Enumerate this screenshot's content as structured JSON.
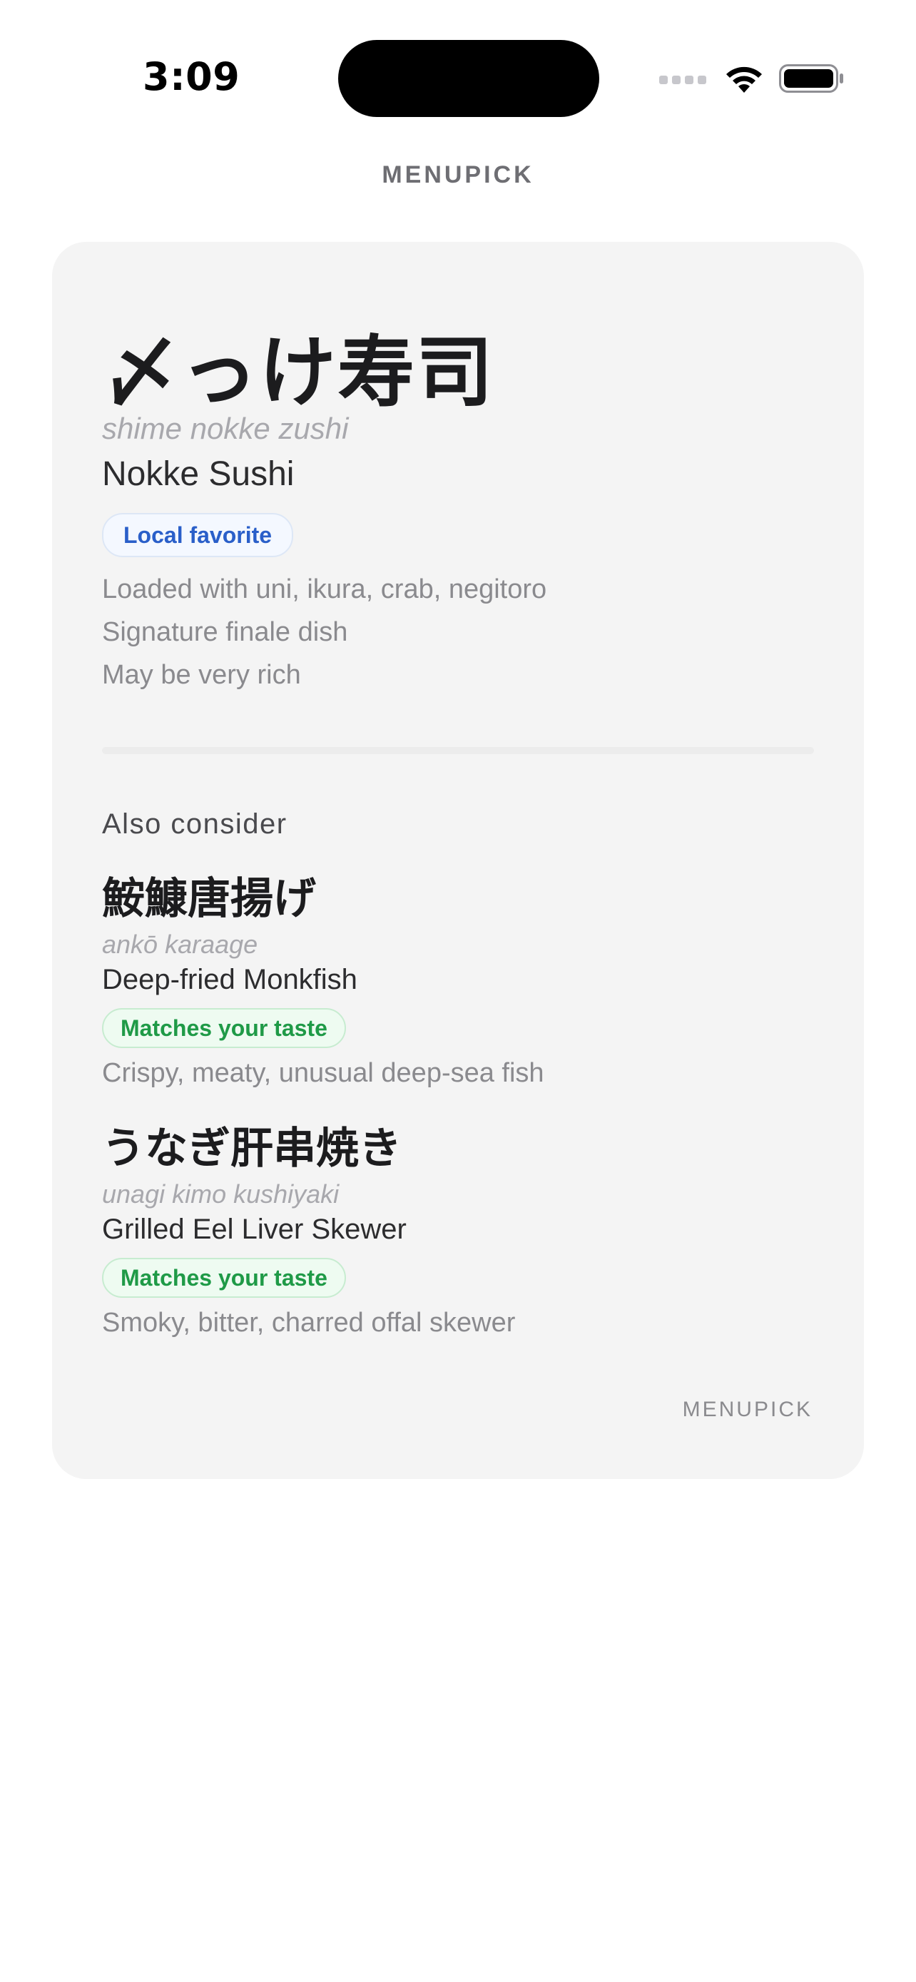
{
  "status_bar": {
    "time": "3:09",
    "icons": [
      "signal-icon",
      "wifi-icon",
      "battery-icon"
    ]
  },
  "header": {
    "title": "MENUPICK"
  },
  "featured": {
    "name": "〆っけ寿司",
    "romaji": "shime nokke zushi",
    "english": "Nokke Sushi",
    "badge": "Local favorite",
    "descriptions": [
      "Loaded with uni, ikura, crab, negitoro",
      "Signature finale dish",
      "May be very rich"
    ]
  },
  "also_consider": {
    "title": "Also consider",
    "items": [
      {
        "name": "鮟鱇唐揚げ",
        "romaji": "ankō karaage",
        "english": "Deep-fried Monkfish",
        "badge": "Matches your taste",
        "description": "Crispy, meaty, unusual deep-sea fish"
      },
      {
        "name": "うなぎ肝串焼き",
        "romaji": "unagi kimo kushiyaki",
        "english": "Grilled Eel Liver Skewer",
        "badge": "Matches your taste",
        "description": "Smoky, bitter, charred offal skewer"
      }
    ]
  },
  "card_footer": {
    "brand": "MENUPICK"
  },
  "colors": {
    "card_background": "#f4f4f4",
    "local_badge_text": "#2a5fc9",
    "match_badge_text": "#1f9a47",
    "muted_text": "#8a8a8e"
  }
}
